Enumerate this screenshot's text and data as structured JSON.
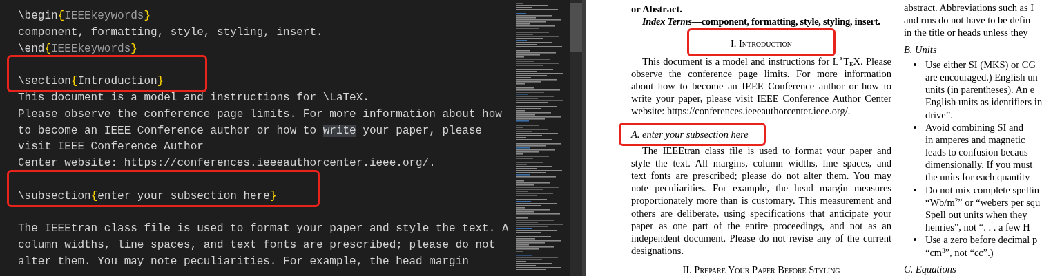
{
  "editor": {
    "lines": [
      {
        "segments": [
          {
            "kind": "text",
            "text": "\\begin"
          },
          {
            "kind": "brace",
            "text": "{"
          },
          {
            "kind": "arg",
            "text": "IEEEkeywords"
          },
          {
            "kind": "brace",
            "text": "}"
          }
        ]
      },
      {
        "segments": [
          {
            "kind": "text",
            "text": "component, formatting, style, styling, insert."
          }
        ]
      },
      {
        "segments": [
          {
            "kind": "text",
            "text": "\\end"
          },
          {
            "kind": "brace",
            "text": "{"
          },
          {
            "kind": "arg",
            "text": "IEEEkeywords"
          },
          {
            "kind": "brace",
            "text": "}"
          }
        ]
      },
      {
        "space_before": true,
        "boxed": true,
        "segments": [
          {
            "kind": "text",
            "text": "\\section"
          },
          {
            "kind": "brace",
            "text": "{"
          },
          {
            "kind": "text",
            "text": "Introduction"
          },
          {
            "kind": "brace",
            "text": "}"
          }
        ]
      },
      {
        "segments": [
          {
            "kind": "text",
            "text": "This document is a model and instructions for \\LaTeX."
          }
        ]
      },
      {
        "segments": [
          {
            "kind": "text",
            "text": "Please observe the conference page limits. For more information about how"
          }
        ]
      },
      {
        "segments": [
          {
            "kind": "text",
            "text": "to become an IEEE Conference author or how to "
          },
          {
            "kind": "highlight",
            "text": "write"
          },
          {
            "kind": "text",
            "text": " your paper, please"
          }
        ]
      },
      {
        "segments": [
          {
            "kind": "text",
            "text": "visit IEEE Conference Author"
          }
        ]
      },
      {
        "segments": [
          {
            "kind": "text",
            "text": "Center website: "
          },
          {
            "kind": "link",
            "text": "https://conferences.ieeeauthorcenter.ieee.org/"
          },
          {
            "kind": "text",
            "text": "."
          }
        ]
      },
      {
        "space_before": true,
        "boxed": true,
        "segments": [
          {
            "kind": "text",
            "text": "\\subsection"
          },
          {
            "kind": "brace",
            "text": "{"
          },
          {
            "kind": "text",
            "text": "enter your subsection here"
          },
          {
            "kind": "brace",
            "text": "}"
          }
        ]
      },
      {
        "space_before": true,
        "segments": [
          {
            "kind": "text",
            "text": "The IEEEtran class file is used to format your paper and style the text. A"
          }
        ]
      },
      {
        "segments": [
          {
            "kind": "text",
            "text": "column widths, line spaces, and text fonts are prescribed; please do not"
          }
        ]
      },
      {
        "segments": [
          {
            "kind": "text",
            "text": "alter them. You may note peculiarities. For example, the head margin"
          }
        ]
      }
    ]
  },
  "pdf": {
    "left": [
      {
        "kind": "bold_lines",
        "lines": [
          "or Abstract."
        ]
      },
      {
        "kind": "index_terms",
        "text": "*Index Terms*—component, formatting, style, styling, insert."
      },
      {
        "kind": "heading",
        "text": "I. Introduction",
        "boxed": true
      },
      {
        "kind": "paragraph",
        "lines": [
          "This document is a model and instructions for L$^{A}$T$_{E}$X. Please",
          "observe the conference page limits. For more information",
          "about how to become an IEEE Conference author or how to",
          "write your paper, please visit IEEE Conference Author Center",
          "website: https://conferences.ieeeauthorcenter.ieee.org/."
        ]
      },
      {
        "kind": "subheading",
        "text": "A. enter your subsection here",
        "boxed": true
      },
      {
        "kind": "paragraph",
        "lines": [
          "The IEEEtran class file is used to format your paper and",
          "style the text. All margins, column widths, line spaces, and",
          "text fonts are prescribed; please do not alter them. You may",
          "note peculiarities. For example, the head margin measures",
          "proportionately more than is customary. This measurement and",
          "others are deliberate, using specifications that anticipate your",
          "paper as one part of the entire proceedings, and not as an",
          "independent document. Please do not revise any of the current",
          "designations."
        ]
      },
      {
        "kind": "heading",
        "text": "II. Prepare Your Paper Before Styling",
        "boxed": false
      }
    ],
    "right": [
      {
        "kind": "lines",
        "lines": [
          "abstract. Abbreviations such as I",
          "and rms do not have to be defin",
          "in the title or heads unless they"
        ]
      },
      {
        "kind": "subheading",
        "text": "B. Units"
      },
      {
        "kind": "bullet",
        "lines": [
          "Use either SI (MKS) or CG",
          "are encouraged.) English un",
          "units (in parentheses). An e",
          "English units as identifiers in",
          "drive”."
        ]
      },
      {
        "kind": "bullet",
        "lines": [
          "Avoid combining SI and",
          "in amperes and magnetic",
          "leads to confusion becaus",
          "dimensionally. If you must",
          "the units for each quantity"
        ]
      },
      {
        "kind": "bullet",
        "lines": [
          "Do not mix complete spellin",
          "“Wb/m$^{2}$” or “webers per squ",
          "Spell out units when they",
          "henries”, not “. . . a few H"
        ]
      },
      {
        "kind": "bullet",
        "lines": [
          "Use a zero before decimal p",
          "“cm$^{3}$”, not “cc”.)"
        ]
      },
      {
        "kind": "subheading",
        "text": "C. Equations"
      }
    ]
  }
}
